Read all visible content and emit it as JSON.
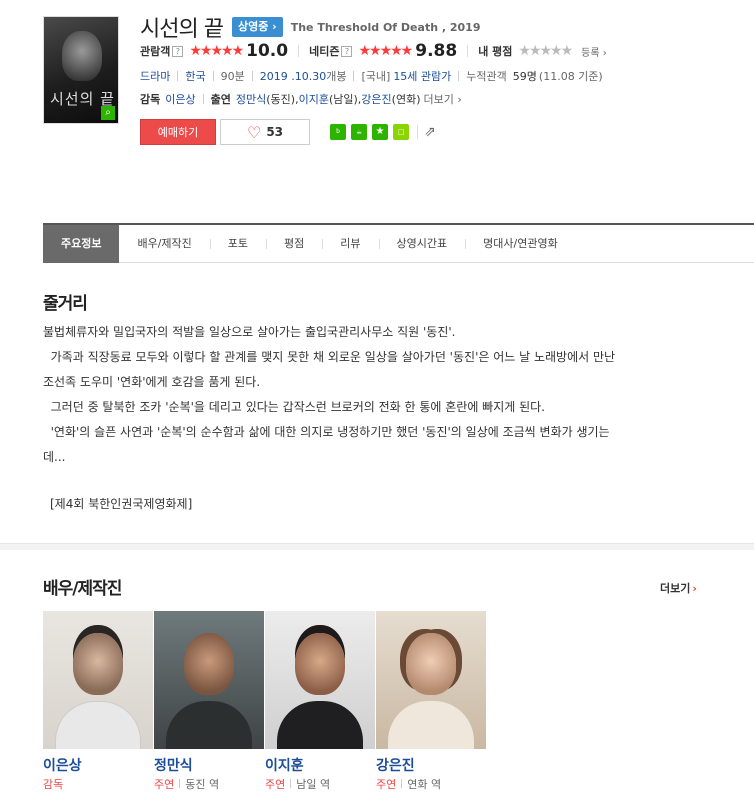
{
  "movie": {
    "title": "시선의 끝",
    "status_badge": "상영중 ›",
    "english_title": "The Threshold Of Death , 2019",
    "ratings": {
      "audience_label": "관람객",
      "audience_stars": "★★★★★",
      "audience_score": "10.0",
      "netizen_label": "네티즌",
      "netizen_stars": "★★★★★",
      "netizen_score": "9.88",
      "my_label": "내 평점",
      "my_stars": "★★★★★",
      "register_link": "등록 ›"
    },
    "info": {
      "genre": "드라마",
      "country": "한국",
      "runtime": "90분",
      "release_date": "2019 .10.30",
      "release_suffix": " 개봉",
      "rating_prefix": "[국내]",
      "rating": "15세 관람가",
      "cumulative_label": "누적관객",
      "cumulative_value": "59명",
      "cumulative_date": "(11.08 기준)"
    },
    "credits": {
      "director_label": "감독",
      "director": "이은상",
      "cast_label": "출연",
      "cast": [
        {
          "name": "정만식",
          "role": "(동진), "
        },
        {
          "name": "이지훈",
          "role": "(남일), "
        },
        {
          "name": "강은진",
          "role": "(연화)"
        }
      ],
      "more_label": "더보기 ›"
    },
    "reserve_button": "예매하기",
    "like_count": "53"
  },
  "share_icons": [
    "blog-icon",
    "cafe-icon",
    "bookmark-star-icon",
    "memo-icon",
    "share-out-icon"
  ],
  "tabs": [
    {
      "label": "주요정보",
      "active": true
    },
    {
      "label": "배우/제작진",
      "active": false
    },
    {
      "label": "포토",
      "active": false
    },
    {
      "label": "평점",
      "active": false
    },
    {
      "label": "리뷰",
      "active": false
    },
    {
      "label": "상영시간표",
      "active": false
    },
    {
      "label": "명대사/연관영화",
      "active": false
    }
  ],
  "synopsis": {
    "heading": "줄거리",
    "lines": [
      "불법체류자와 밀입국자의 적발을 일상으로 살아가는 출입국관리사무소 직원 '동진'.",
      "  가족과 직장동료 모두와 이렇다 할 관계를 맺지 못한 채 외로운 일상을 살아가던 '동진'은 어느 날 노래방에서 만난",
      "조선족 도우미 '연화'에게 호감을 품게 된다.",
      "  그러던 중 탈북한 조카 '순복'을 데리고 있다는 갑작스런 브로커의 전화 한 통에 혼란에 빠지게 된다.",
      "  '연화'의 슬픈 사연과 '순복'의 순수함과 삶에 대한 의지로 냉정하기만 했던 '동진'의 일상에 조금씩 변화가 생기는",
      "데..."
    ],
    "festival": "[제4회 북한인권국제영화제]"
  },
  "cast_section": {
    "heading": "배우/제작진",
    "more_label": "더보기",
    "people": [
      {
        "name": "이은상",
        "role_label": "감독",
        "character": ""
      },
      {
        "name": "정만식",
        "role_label": "주연",
        "character": "동진 역"
      },
      {
        "name": "이지훈",
        "role_label": "주연",
        "character": "남일 역"
      },
      {
        "name": "강은진",
        "role_label": "주연",
        "character": "연화 역"
      }
    ]
  },
  "colors": {
    "star_red": "#ff3a3a",
    "link_blue": "#1b4d9b",
    "reserve_red": "#ed4a4a",
    "badge_blue": "#3a8fd3",
    "naver_green": "#2db400"
  }
}
